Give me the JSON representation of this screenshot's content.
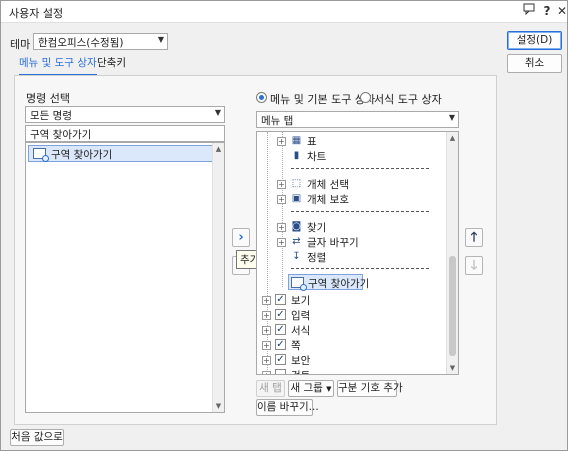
{
  "window": {
    "title": "사용자 설정",
    "icons": [
      "chat-icon",
      "help-icon",
      "close-icon"
    ]
  },
  "theme": {
    "label": "테마",
    "selected": "한컴오피스(수정됨)"
  },
  "buttons": {
    "ok": "설정(D)",
    "cancel": "취소",
    "reset": "처음 값으로",
    "new_tab": "새 탭",
    "new_group": "새 그룹",
    "add_separator": "구분 기호 추가",
    "rename": "이름 바꾸기..."
  },
  "tabs": [
    {
      "label": "메뉴 및 도구 상자",
      "active": true
    },
    {
      "label": "단축키",
      "active": false
    }
  ],
  "command_select": {
    "label": "명령 선택",
    "category": "모든 명령",
    "search_value": "구역 찾아가기",
    "items": [
      "구역 찾아가기"
    ]
  },
  "target_select": {
    "options": [
      {
        "label": "메뉴 및 기본 도구 상자",
        "selected": true
      },
      {
        "label": "서식 도구 상자",
        "selected": false
      }
    ],
    "combo": "메뉴 탭"
  },
  "tree": {
    "items": [
      {
        "label": "표",
        "icon": "table-icon",
        "kind": "child"
      },
      {
        "label": "차트",
        "icon": "chart-icon",
        "kind": "child"
      },
      {
        "label": "개체 선택",
        "icon": "object-select-icon",
        "kind": "child"
      },
      {
        "label": "개체 보호",
        "icon": "object-protect-icon",
        "kind": "child"
      },
      {
        "label": "찾기",
        "icon": "binoculars-icon",
        "kind": "child"
      },
      {
        "label": "글자 바꾸기",
        "icon": "replace-icon",
        "kind": "child"
      },
      {
        "label": "정렬",
        "icon": "sort-icon",
        "kind": "child"
      },
      {
        "label": "구역 찾아가기",
        "icon": "goto-section-icon",
        "kind": "selected"
      },
      {
        "label": "보기",
        "checked": true,
        "kind": "top"
      },
      {
        "label": "입력",
        "checked": true,
        "kind": "top"
      },
      {
        "label": "서식",
        "checked": true,
        "kind": "top"
      },
      {
        "label": "쪽",
        "checked": true,
        "kind": "top"
      },
      {
        "label": "보안",
        "checked": true,
        "kind": "top"
      },
      {
        "label": "검토",
        "checked": false,
        "kind": "top"
      }
    ]
  },
  "transfer": {
    "add_tooltip": "추가"
  },
  "colors": {
    "accent": "#2a6fd6",
    "selection": "#dbe8fb"
  }
}
